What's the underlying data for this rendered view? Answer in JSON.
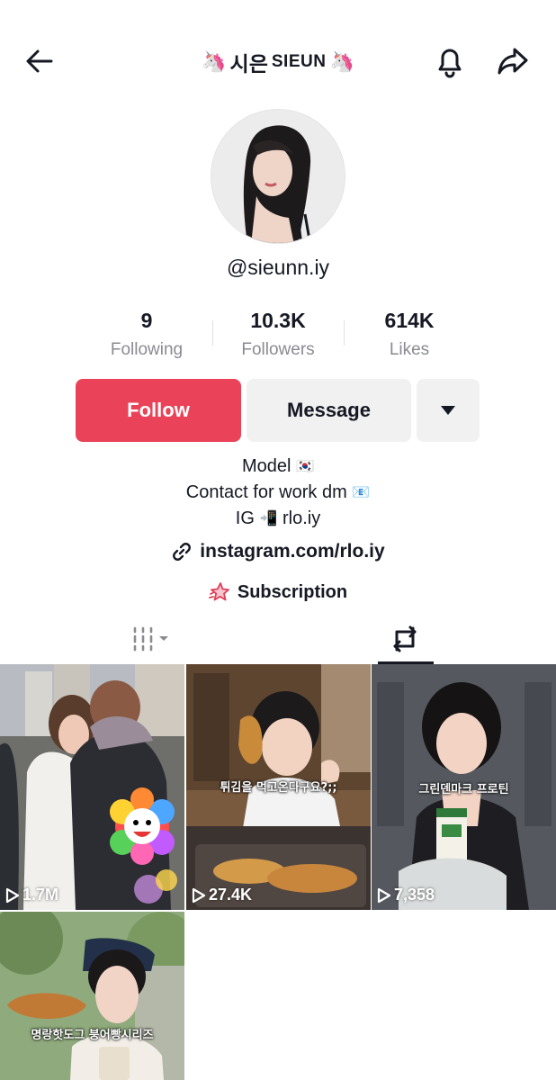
{
  "header": {
    "title_emoji_left": "🦄",
    "title_korean": "시은",
    "title_latin": "SIEUN",
    "title_emoji_right": "🦄",
    "back_icon": "arrow-left-icon",
    "bell_icon": "bell-icon",
    "share_icon": "share-icon"
  },
  "profile": {
    "handle": "@sieunn.iy",
    "stats": [
      {
        "value": "9",
        "label": "Following"
      },
      {
        "value": "10.3K",
        "label": "Followers"
      },
      {
        "value": "614K",
        "label": "Likes"
      }
    ],
    "follow_label": "Follow",
    "message_label": "Message",
    "bio_line1": "Model",
    "bio_line1_emoji": "🇰🇷",
    "bio_line2": "Contact for work dm",
    "bio_line2_emoji": "📧",
    "bio_line3_prefix": "IG",
    "bio_line3_emoji": "📲",
    "bio_line3_suffix": "rlo.iy",
    "link": "instagram.com/rlo.iy",
    "subscription_label": "Subscription"
  },
  "colors": {
    "follow": "#ea4359",
    "secondary_button": "#f1f1f2",
    "text": "#161823",
    "muted": "#8a8b91"
  },
  "videos": [
    {
      "views": "1.7M",
      "caption": ""
    },
    {
      "views": "27.4K",
      "caption": "튀김을 먹고온다구요?;;"
    },
    {
      "views": "7,358",
      "caption": "그린덴마크 프로틴"
    },
    {
      "views": "",
      "caption": "명랑핫도그 붕어빵시리즈"
    }
  ]
}
